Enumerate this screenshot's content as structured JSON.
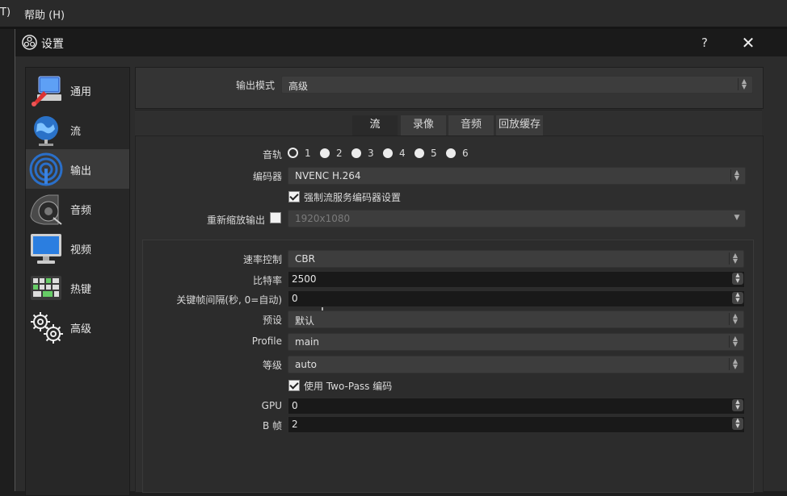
{
  "menubar": {
    "item_partial": "T)",
    "help": "帮助 (H)"
  },
  "window": {
    "title": "设置",
    "help": "?",
    "close": "✕"
  },
  "sidebar": {
    "items": [
      {
        "label": "通用",
        "icon": "general-icon",
        "active": false
      },
      {
        "label": "流",
        "icon": "stream-icon",
        "active": false
      },
      {
        "label": "输出",
        "icon": "output-icon",
        "active": true
      },
      {
        "label": "音频",
        "icon": "audio-icon",
        "active": false
      },
      {
        "label": "视频",
        "icon": "video-icon",
        "active": false
      },
      {
        "label": "热键",
        "icon": "hotkeys-icon",
        "active": false
      },
      {
        "label": "高级",
        "icon": "advanced-icon",
        "active": false
      }
    ]
  },
  "output": {
    "mode_label": "输出模式",
    "mode_value": "高级",
    "tabs": [
      "流",
      "录像",
      "音频",
      "回放缓存"
    ],
    "active_tab": "流",
    "audio_track_label": "音轨",
    "tracks": [
      "1",
      "2",
      "3",
      "4",
      "5",
      "6"
    ],
    "selected_track": "1",
    "encoder_label": "编码器",
    "encoder_value": "NVENC H.264",
    "enforce_label": "强制流服务编码器设置",
    "enforce_checked": true,
    "rescale_label": "重新缩放输出",
    "rescale_checked": false,
    "rescale_value": "1920x1080"
  },
  "encoder_settings": {
    "rate_control_label": "速率控制",
    "rate_control_value": "CBR",
    "bitrate_label": "比特率",
    "bitrate_value": "2500",
    "keyframe_label": "关键帧间隔(秒, 0=自动)",
    "keyframe_value": "0",
    "preset_label": "预设",
    "preset_value": "默认",
    "profile_label": "Profile",
    "profile_value": "main",
    "level_label": "等级",
    "level_value": "auto",
    "twopass_label": "使用 Two-Pass 编码",
    "twopass_checked": true,
    "gpu_label": "GPU",
    "gpu_value": "0",
    "bframes_label": "B 帧",
    "bframes_value": "2"
  },
  "colors": {
    "window_bg": "#2c2c2c",
    "titlebar": "#1a1a1a",
    "input_bg": "#3d3d3d",
    "spin_bg": "#191919",
    "active_sidebar": "#3a3a3a"
  }
}
